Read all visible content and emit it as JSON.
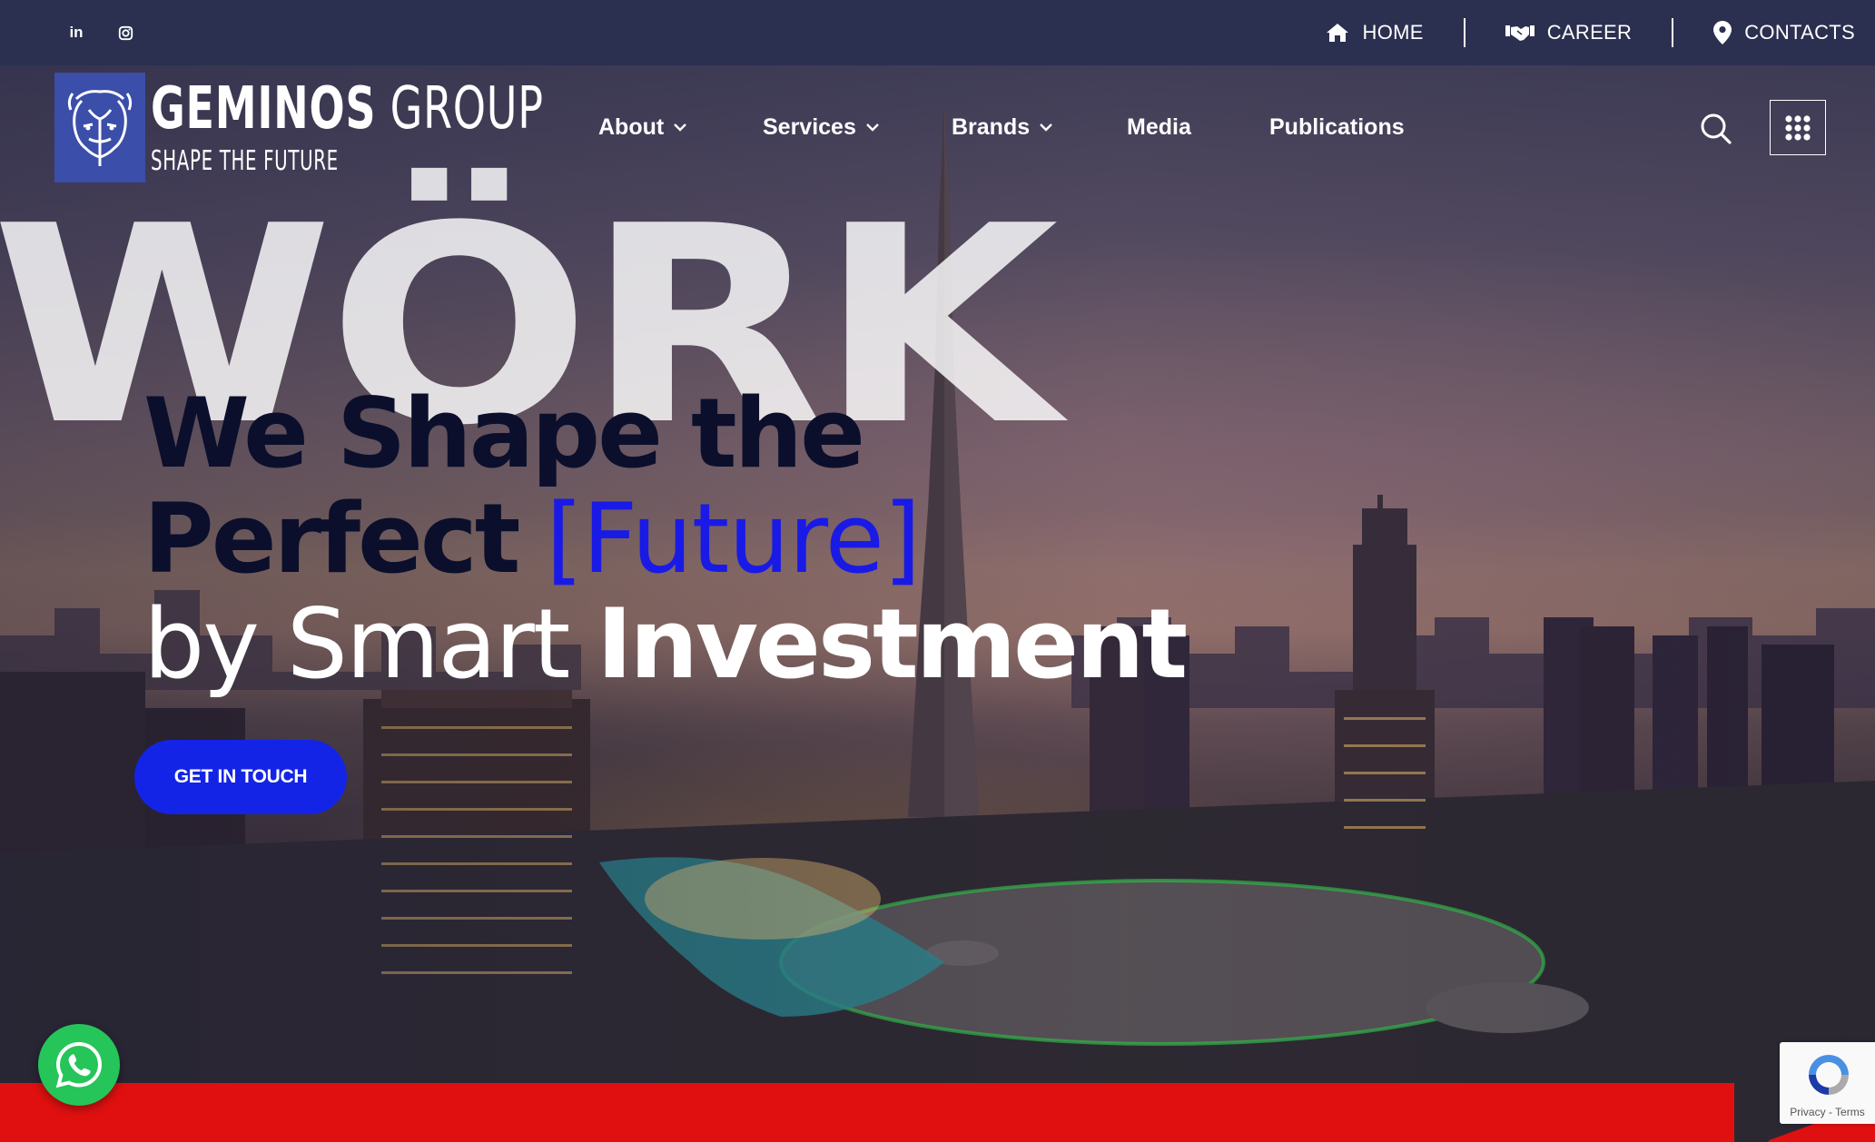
{
  "top_bar": {
    "social": [
      {
        "icon": "linkedin-icon",
        "label": "in"
      },
      {
        "icon": "instagram-icon"
      }
    ],
    "links": [
      {
        "icon": "home-icon",
        "label": "HOME"
      },
      {
        "icon": "handshake-icon",
        "label": "CAREER"
      },
      {
        "icon": "location-pin-icon",
        "label": "CONTACTS"
      }
    ]
  },
  "brand": {
    "name_bold": "GEMINOS",
    "name_light": "GROUP",
    "tagline": "SHAPE THE FUTURE"
  },
  "nav": {
    "items": [
      {
        "label": "About",
        "has_dropdown": true
      },
      {
        "label": "Services",
        "has_dropdown": true
      },
      {
        "label": "Brands",
        "has_dropdown": true
      },
      {
        "label": "Media",
        "has_dropdown": false
      },
      {
        "label": "Publications",
        "has_dropdown": false
      }
    ],
    "search_icon": "search-icon",
    "apps_icon": "grid-menu-icon"
  },
  "hero": {
    "background_word": "WÖRK",
    "line1": "We Shape the",
    "line2_bold": "Perfect",
    "line2_accent": "[Future]",
    "line3_thin": "by Smart",
    "line3_bold": "Investment",
    "cta_label": "GET IN TOUCH"
  },
  "widgets": {
    "whatsapp_icon": "whatsapp-icon",
    "recaptcha_terms": "Privacy - Terms"
  },
  "colors": {
    "top_bar_bg": "#2b3050",
    "logo_bg": "#3b4eaa",
    "headline_dark": "#0b0f2c",
    "accent_blue": "#1a1ae6",
    "cta_bg": "#1424e6",
    "red_band": "#e01010",
    "whatsapp_green": "#25c55a"
  }
}
